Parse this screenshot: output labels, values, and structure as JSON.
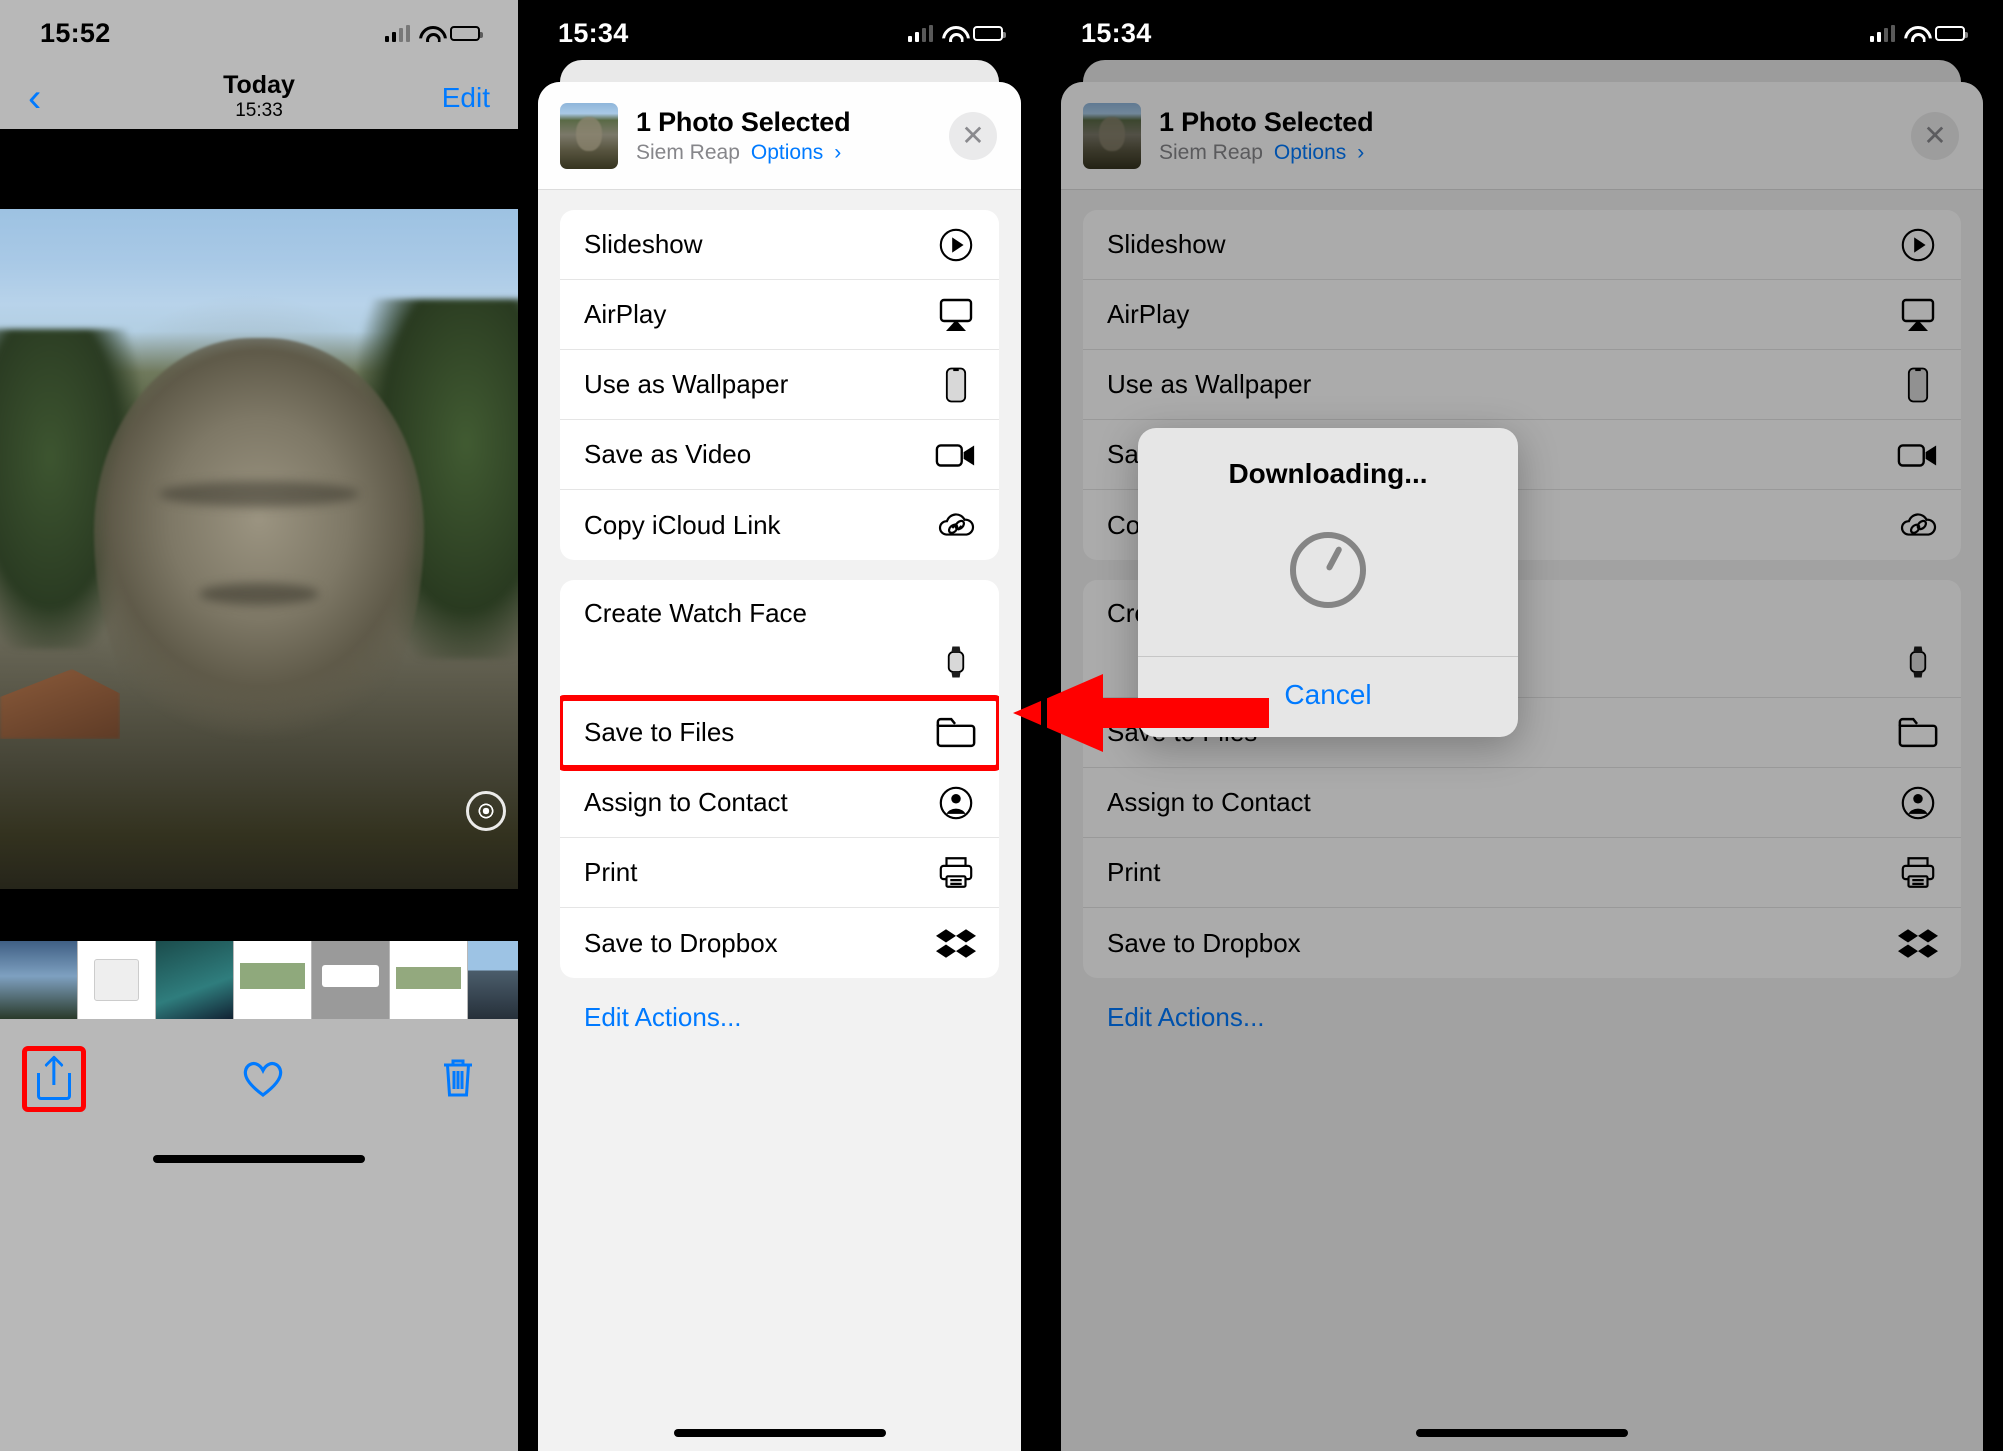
{
  "panel1": {
    "status": {
      "time": "15:52"
    },
    "nav": {
      "back_icon": "chevron-left-icon",
      "title": "Today",
      "subtitle": "15:33",
      "edit_label": "Edit"
    },
    "photo": {
      "alt": "Bayon temple stone face, Siem Reap"
    },
    "toolbar": {
      "share_icon": "share-icon",
      "favorite_icon": "heart-icon",
      "delete_icon": "trash-icon"
    }
  },
  "panel2": {
    "status": {
      "time": "15:34"
    },
    "sheet_header": {
      "title": "1 Photo Selected",
      "location": "Siem Reap",
      "options_label": "Options",
      "options_chevron": "chevron-right-icon",
      "close_icon": "close-icon"
    },
    "groups": [
      {
        "rows": [
          {
            "label": "Slideshow",
            "icon": "play-circle-icon"
          },
          {
            "label": "AirPlay",
            "icon": "airplay-icon"
          },
          {
            "label": "Use as Wallpaper",
            "icon": "iphone-icon"
          },
          {
            "label": "Save as Video",
            "icon": "video-camera-icon"
          },
          {
            "label": "Copy iCloud Link",
            "icon": "cloud-link-icon"
          }
        ]
      },
      {
        "rows": [
          {
            "label": "Create Watch Face",
            "icon": "apple-watch-icon",
            "tall": true
          },
          {
            "label": "Save to Files",
            "icon": "folder-icon",
            "highlighted": true
          },
          {
            "label": "Assign to Contact",
            "icon": "contact-icon"
          },
          {
            "label": "Print",
            "icon": "printer-icon"
          },
          {
            "label": "Save to Dropbox",
            "icon": "dropbox-icon"
          }
        ]
      }
    ],
    "edit_actions_label": "Edit Actions..."
  },
  "panel3": {
    "status": {
      "time": "15:34"
    },
    "sheet_header": {
      "title": "1 Photo Selected",
      "location": "Siem Reap",
      "options_label": "Options",
      "options_chevron": "chevron-right-icon",
      "close_icon": "close-icon"
    },
    "groups": [
      {
        "rows": [
          {
            "label": "Slideshow",
            "icon": "play-circle-icon"
          },
          {
            "label": "AirPlay",
            "icon": "airplay-icon"
          },
          {
            "label": "Use as Wallpaper",
            "icon": "iphone-icon"
          },
          {
            "label": "Save as Video",
            "icon": "video-camera-icon"
          },
          {
            "label": "Copy iCloud Link",
            "icon": "cloud-link-icon"
          }
        ]
      },
      {
        "rows": [
          {
            "label": "Create Watch Face",
            "icon": "apple-watch-icon",
            "tall": true
          },
          {
            "label": "Save to Files",
            "icon": "folder-icon"
          },
          {
            "label": "Assign to Contact",
            "icon": "contact-icon"
          },
          {
            "label": "Print",
            "icon": "printer-icon"
          },
          {
            "label": "Save to Dropbox",
            "icon": "dropbox-icon"
          }
        ]
      }
    ],
    "edit_actions_label": "Edit Actions...",
    "alert": {
      "title": "Downloading...",
      "spinner_icon": "progress-spinner-icon",
      "cancel_label": "Cancel"
    }
  },
  "annotation": {
    "arrow_color": "#ff0000",
    "highlight_color": "#ff0000"
  }
}
